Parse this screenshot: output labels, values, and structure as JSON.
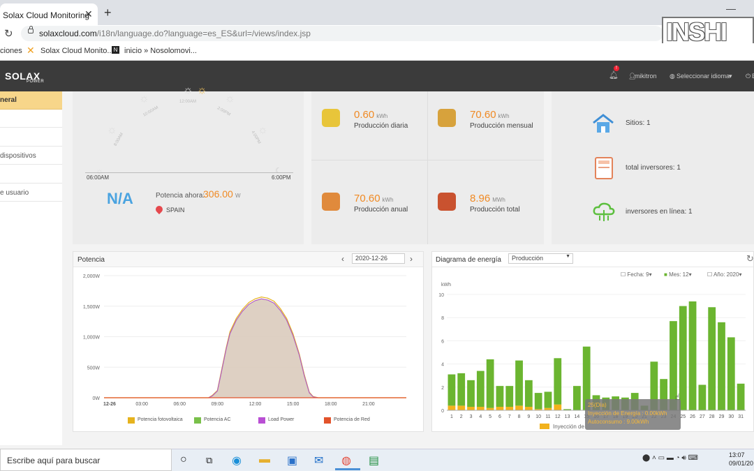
{
  "browser": {
    "tab_title": "Solax Cloud Monitoring",
    "tab_close": "✕",
    "new_tab": "+",
    "url_host": "solaxcloud.com",
    "url_path": "/i18n/language.do?language=es_ES&url=/views/index.jsp",
    "minimize": "—",
    "watermark": "INSHI",
    "bookmarks": [
      "ciones",
      "Solax Cloud Monito...",
      "inicio » Nosolomovi..."
    ]
  },
  "app": {
    "logo": "SOLAX",
    "logo_sub": "POWER",
    "bell_badge": "!",
    "user": "mikitron",
    "language": "Seleccionar idioma",
    "logout": "E"
  },
  "sidebar": {
    "active": "neral",
    "items": [
      "",
      "dispositivos",
      "e usuario"
    ]
  },
  "sun_card": {
    "times": [
      "12:00AM",
      "10:00AM",
      "2:00PM",
      "8:00AM",
      "4:00PM"
    ],
    "start": "06:00AM",
    "end": "6:00PM",
    "status": "N/A",
    "power_label": "Potencia ahora: ",
    "power_value": "306.00",
    "power_unit": "W",
    "location": "SPAIN"
  },
  "stats": [
    {
      "value": "0.60",
      "unit": "kWh",
      "label": "Producción diaria",
      "color": "#e8c53a",
      "icon": "daily-icon"
    },
    {
      "value": "70.60",
      "unit": "kWh",
      "label": "Producción mensual",
      "color": "#d7a23c",
      "icon": "calendar-icon"
    },
    {
      "value": "70.60",
      "unit": "kWh",
      "label": "Producción anual",
      "color": "#e08a3c",
      "icon": "globe-icon"
    },
    {
      "value": "8.96",
      "unit": "MWh",
      "label": "Producción total",
      "color": "#c9522f",
      "icon": "bolt-icon"
    }
  ],
  "info": {
    "sites": "Sitios: 1",
    "inverters": "total inversores: 1",
    "online": "inversores en línea: 1"
  },
  "power_panel": {
    "title": "Potencia",
    "date": "2020-12-26",
    "prev": "‹",
    "next": "›",
    "legend": [
      "Potencia fotovoltaica",
      "Potencia AC",
      "Load Power",
      "Potencia de Red"
    ],
    "legend_colors": [
      "#e6b31e",
      "#79c04a",
      "#b94fd4",
      "#e2532b"
    ]
  },
  "energy_panel": {
    "title": "Diagrama de energía",
    "select": "Producción",
    "fecha_label": "Fecha:",
    "fecha_val": "9",
    "mes_label": "Mes:",
    "mes_val": "12",
    "anio_label": "Año:",
    "anio_val": "2020",
    "unit": "kWh",
    "legend_partial": "Inyección de",
    "tooltip": [
      "25(Día)",
      "Inyección de Energía : 0.00kWh",
      "Autoconsumo : 9.00kWh"
    ]
  },
  "chart_data": [
    {
      "type": "area",
      "title": "Potencia",
      "x_ticks": [
        "12-26",
        "03:00",
        "06:00",
        "09:00",
        "12:00",
        "15:00",
        "18:00",
        "21:00"
      ],
      "y_ticks": [
        "0W",
        "500W",
        "1,000W",
        "1,500W",
        "2,000W"
      ],
      "ylim": [
        0,
        2000
      ],
      "x": [
        0,
        8.3,
        8.6,
        9.0,
        9.3,
        9.7,
        10.0,
        10.5,
        11.0,
        11.5,
        12.0,
        12.5,
        13.0,
        13.5,
        14.0,
        14.5,
        15.0,
        15.5,
        15.9,
        16.3,
        16.6,
        17.0,
        24
      ],
      "series": [
        {
          "name": "Potencia fotovoltaica",
          "values": [
            0,
            0,
            40,
            120,
            420,
            820,
            1080,
            1300,
            1450,
            1560,
            1620,
            1650,
            1630,
            1580,
            1460,
            1300,
            1050,
            720,
            380,
            90,
            20,
            0,
            0
          ]
        },
        {
          "name": "Potencia AC",
          "values": [
            0,
            0,
            30,
            110,
            400,
            800,
            1050,
            1270,
            1420,
            1530,
            1590,
            1620,
            1600,
            1550,
            1430,
            1270,
            1020,
            700,
            360,
            80,
            15,
            0,
            0
          ]
        },
        {
          "name": "Load Power",
          "values": [
            0,
            0,
            30,
            110,
            400,
            800,
            1050,
            1270,
            1420,
            1530,
            1590,
            1620,
            1600,
            1550,
            1430,
            1270,
            1020,
            700,
            360,
            80,
            15,
            0,
            0
          ]
        }
      ]
    },
    {
      "type": "bar",
      "title": "Diagrama de energía",
      "ylabel": "kWh",
      "ylim": [
        0,
        10
      ],
      "y_ticks": [
        "0",
        "2",
        "4",
        "6",
        "8",
        "10"
      ],
      "categories": [
        "1",
        "2",
        "3",
        "4",
        "5",
        "6",
        "7",
        "8",
        "9",
        "10",
        "11",
        "12",
        "13",
        "14",
        "15",
        "16",
        "17",
        "18",
        "19",
        "20",
        "21",
        "22",
        "23",
        "24",
        "25",
        "26",
        "27",
        "28",
        "29",
        "30",
        "31"
      ],
      "series": [
        {
          "name": "Inyección de Energía",
          "values": [
            0.4,
            0.4,
            0.3,
            0.3,
            0.2,
            0.3,
            0.3,
            0.4,
            0.3,
            0.1,
            0.2,
            0.5,
            0,
            0,
            0,
            0,
            0,
            0,
            0,
            0,
            0,
            0,
            0,
            0,
            0,
            0,
            0,
            0,
            0,
            0,
            0
          ]
        },
        {
          "name": "Autoconsumo",
          "values": [
            2.7,
            2.8,
            2.3,
            3.1,
            4.2,
            1.8,
            1.8,
            3.9,
            2.3,
            1.4,
            1.4,
            4.0,
            0.1,
            2.1,
            5.5,
            1.3,
            1.1,
            1.2,
            1.1,
            1.5,
            0.4,
            4.2,
            2.7,
            7.7,
            9.0,
            9.4,
            2.2,
            8.9,
            7.6,
            6.3,
            2.3
          ]
        }
      ],
      "colors": [
        "#f2b21d",
        "#6bb530"
      ]
    }
  ],
  "taskbar": {
    "search": "Escribe aquí para buscar",
    "clock_time": "13:07",
    "clock_date": "09/01/20"
  }
}
